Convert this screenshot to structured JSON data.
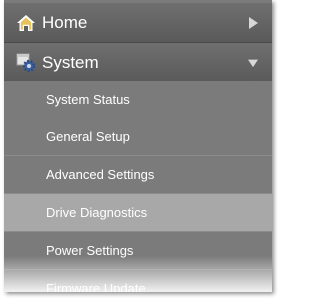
{
  "nav": {
    "home": {
      "label": "Home",
      "icon": "home-icon",
      "indicator": "chevron-right-icon"
    },
    "system": {
      "label": "System",
      "icon": "gear-icon",
      "indicator": "chevron-down-icon",
      "expanded": true
    },
    "submenu": [
      {
        "label": "System Status"
      },
      {
        "label": "General Setup"
      },
      {
        "label": "Advanced Settings"
      },
      {
        "label": "Drive Diagnostics",
        "active": true
      },
      {
        "label": "Power Settings"
      },
      {
        "label": "Firmware Update"
      }
    ]
  },
  "colors": {
    "header_bg": "#666666",
    "submenu_bg": "#7b7b7b",
    "active_bg": "#a8a8a8",
    "text": "#ffffff",
    "home_icon": "#e8c25a"
  }
}
